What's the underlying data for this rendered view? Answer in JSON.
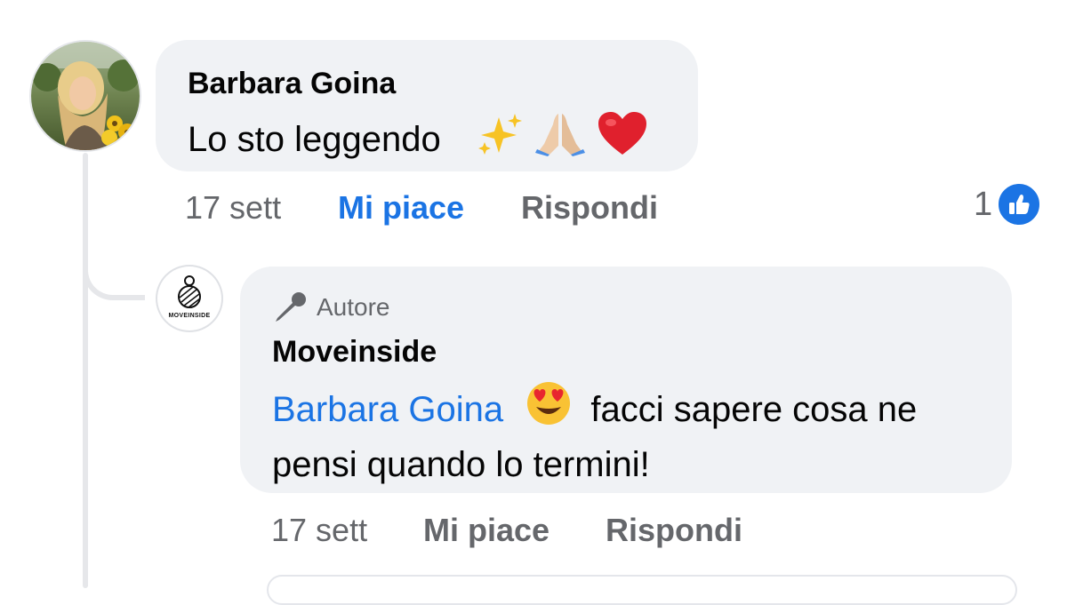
{
  "comments": [
    {
      "author": "Barbara Goina",
      "text": "Lo sto leggendo",
      "emojis": [
        "sparkles-icon",
        "folded-hands-icon",
        "red-heart-icon"
      ],
      "time": "17 sett",
      "like_label": "Mi piace",
      "reply_label": "Rispondi",
      "like_active": true,
      "reaction_count": "1",
      "colors": {
        "like_active": "#1b74e4",
        "bubble": "#f0f2f5",
        "meta": "#65676b"
      }
    }
  ],
  "reply": {
    "badge": "Autore",
    "badge_icon": "microphone-icon",
    "author": "Moveinside",
    "avatar_text": "MOVEINSIDE",
    "mention": "Barbara Goina",
    "emoji": "heart-eyes-emoji-icon",
    "text_line1": "facci sapere cosa ne",
    "text_line2": "pensi quando lo termini!",
    "time": "17 sett",
    "like_label": "Mi piace",
    "reply_label": "Rispondi"
  }
}
